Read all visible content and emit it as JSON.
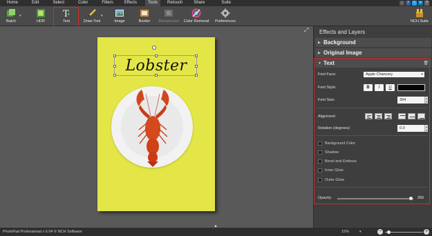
{
  "menu": [
    "Home",
    "Edit",
    "Select",
    "Color",
    "Filters",
    "Effects",
    "Tools",
    "Retouch",
    "Share",
    "Suite"
  ],
  "menu_active": "Tools",
  "toolbar": {
    "batch": "Batch",
    "hdr": "HDR",
    "text": "Text",
    "draw_tool": "Draw Tool",
    "image": "Image",
    "border": "Border",
    "background": "Background",
    "color_removal": "Color Removal",
    "preferences": "Preferences",
    "nch_suite": "NCH Suite"
  },
  "canvas": {
    "overlay_text": "Lobster"
  },
  "panel": {
    "title": "Effects and Layers",
    "sections": [
      "Background",
      "Original Image",
      "Text"
    ],
    "font_face_label": "Font Face:",
    "font_face_value": "Apple Chancery",
    "font_style_label": "Font Style:",
    "bold": "B",
    "italic": "I",
    "underline": "U",
    "font_size_label": "Font Size:",
    "font_size_value": "394",
    "alignment_label": "Alignment:",
    "rotation_label": "Rotation (degrees):",
    "rotation_value": "0.0",
    "effects": [
      "Background Color",
      "Shadow",
      "Bevel and Emboss",
      "Inner Glow",
      "Outer Glow"
    ],
    "opacity_label": "Opacity:",
    "opacity_value": "255"
  },
  "status": {
    "app_version": "PhotoPad Professional v 6.04 © NCH Software",
    "zoom": "15%"
  },
  "colors": {
    "highlight": "#d42a2a",
    "photo_bg": "#e4e648",
    "text_color": "#050505"
  }
}
